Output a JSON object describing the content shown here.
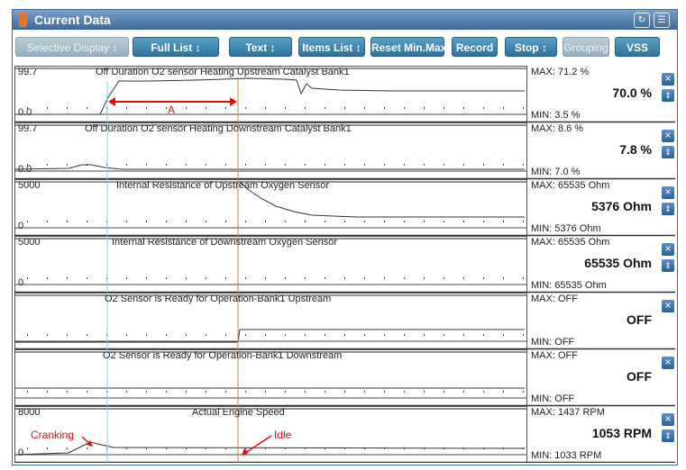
{
  "window": {
    "title": "Current Data"
  },
  "toolbar": [
    {
      "label": "Selective Display",
      "dropdown": true,
      "enabled": false
    },
    {
      "label": "Full List",
      "dropdown": true,
      "enabled": true
    },
    {
      "label": "Text",
      "dropdown": true,
      "enabled": true
    },
    {
      "label": "Items List",
      "dropdown": true,
      "enabled": true
    },
    {
      "label": "Reset Min.Max",
      "dropdown": false,
      "enabled": true
    },
    {
      "label": "Record",
      "dropdown": false,
      "enabled": true
    },
    {
      "label": "Stop",
      "dropdown": true,
      "enabled": true
    },
    {
      "label": "Grouping",
      "dropdown": false,
      "enabled": false
    },
    {
      "label": "VSS",
      "dropdown": false,
      "enabled": true
    }
  ],
  "panels": [
    {
      "title": "Off Duration O2 sensor Heating Upstream Catalyst Bank1",
      "ymax": "99.7",
      "ymin": "0.0",
      "max": "MAX:  71.2 %",
      "current": "70.0 %",
      "min": "MIN:   3.5 %",
      "current_color": "#111111"
    },
    {
      "title": "Off Duration O2 sensor Heating Downstream Catalyst Bank1",
      "ymax": "99.7",
      "ymin": "0.0",
      "max": "MAX:   8.6 %",
      "current": "7.8 %",
      "min": "MIN:   7.0 %",
      "current_color": "#111111"
    },
    {
      "title": "Internal Resistance of Upstream Oxygen Sensor",
      "ymax": "5000",
      "ymin": "0",
      "max": "MAX: 65535 Ohm",
      "current": "5376 Ohm",
      "min": "MIN:  5376 Ohm",
      "current_color": "#111111"
    },
    {
      "title": "Internal Resistance of Downstream Oxygen Sensor",
      "ymax": "5000",
      "ymin": "0",
      "max": "MAX: 65535 Ohm",
      "current": "65535 Ohm",
      "min": "MIN: 65535 Ohm",
      "current_color": "#111111"
    },
    {
      "title": "O2 Sensor is Ready for Operation-Bank1 Upstream",
      "ymax": "",
      "ymin": "",
      "max": "MAX: OFF",
      "current": "OFF",
      "min": "MIN: OFF",
      "current_color": "#111111"
    },
    {
      "title": "O2 Sensor is Ready for Operation-Bank1 Downstream",
      "ymax": "",
      "ymin": "",
      "max": "MAX: OFF",
      "current": "OFF",
      "min": "MIN: OFF",
      "current_color": "#111111"
    },
    {
      "title": "Actual Engine Speed",
      "ymax": "8000",
      "ymin": "0",
      "max": "MAX:  1437 RPM",
      "current": "1053 RPM",
      "min": "MIN:  1033 RPM",
      "current_color": "#111111"
    }
  ],
  "annotations": {
    "a": "A",
    "cranking": "Cranking",
    "idle": "Idle"
  },
  "colors": {
    "cursor_cyan": "#7fd0e0",
    "cursor_orange": "#e0843a",
    "annotation_red": "#e01010"
  }
}
